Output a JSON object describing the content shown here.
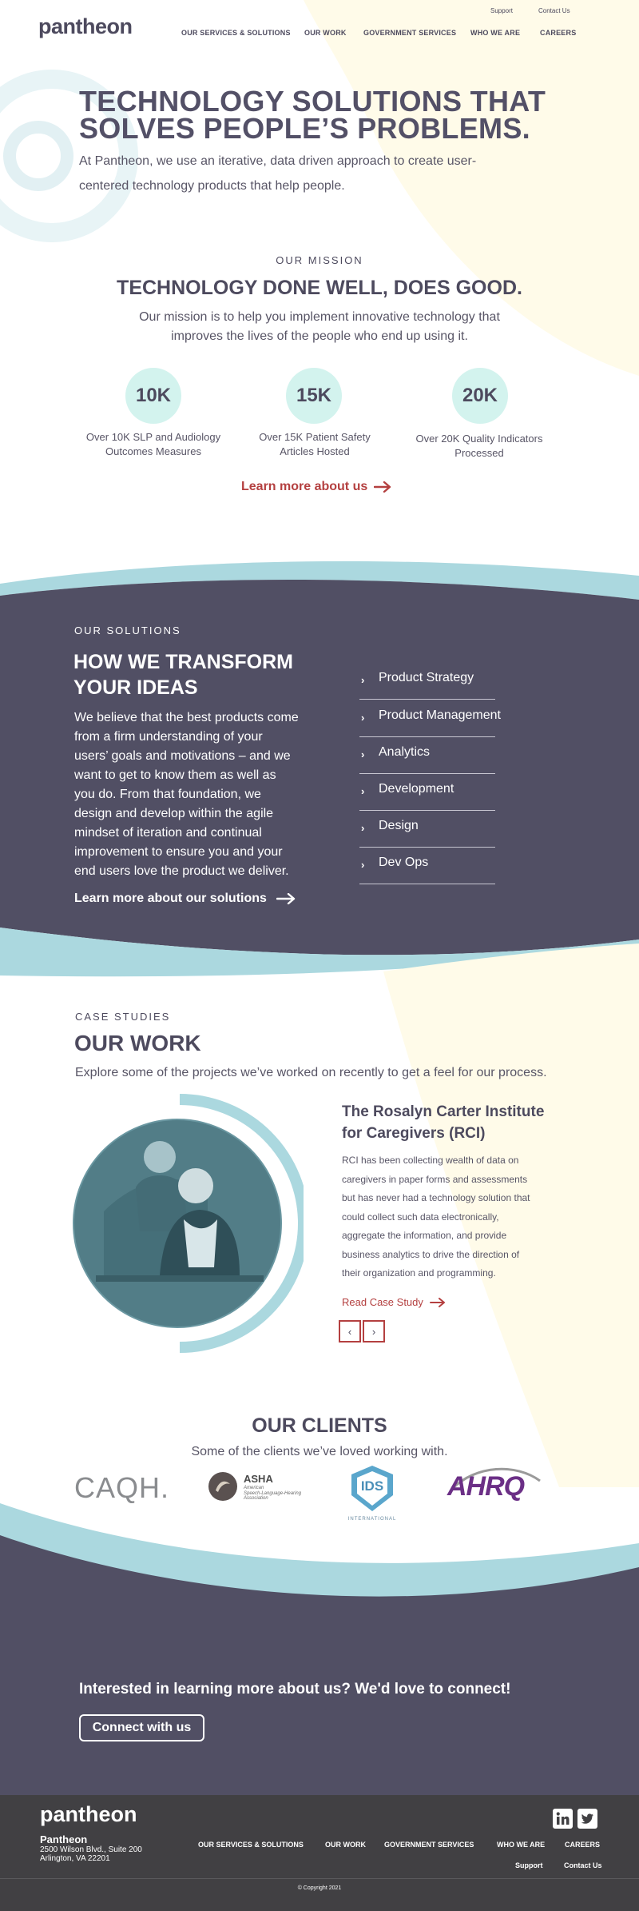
{
  "header": {
    "logo": "pantheon",
    "utility": [
      "Support",
      "Contact Us"
    ],
    "nav": [
      "OUR SERVICES & SOLUTIONS",
      "OUR WORK",
      "GOVERNMENT SERVICES",
      "WHO WE ARE",
      "CAREERS"
    ]
  },
  "hero": {
    "title_line1": "TECHNOLOGY SOLUTIONS THAT",
    "title_line2": "SOLVES PEOPLE’S PROBLEMS.",
    "desc_line1": "At Pantheon, we use an iterative, data driven approach to create user-",
    "desc_line2": "centered technology products that help people."
  },
  "mission": {
    "eyebrow": "OUR MISSION",
    "title": "TECHNOLOGY DONE WELL, DOES GOOD.",
    "desc_line1": "Our mission is to help you implement innovative technology that",
    "desc_line2": "improves the lives of the people who end up using it.",
    "stats": [
      {
        "value": "10K",
        "label_line1": "Over 10K SLP and Audiology",
        "label_line2": "Outcomes Measures"
      },
      {
        "value": "15K",
        "label_line1": "Over 15K Patient Safety",
        "label_line2": "Articles Hosted"
      },
      {
        "value": "20K",
        "label_line1": "Over 20K Quality Indicators",
        "label_line2": "Processed"
      }
    ],
    "link": "Learn more about us"
  },
  "solutions": {
    "eyebrow": "OUR SOLUTIONS",
    "title_line1": "HOW WE TRANSFORM",
    "title_line2": "YOUR IDEAS",
    "desc_lines": [
      "We believe that the best products come",
      "from a firm understanding of your",
      "users’ goals and motivations – and we",
      "want to get to know them as well as",
      "you do. From that foundation, we",
      "design and develop within the agile",
      "mindset of iteration and continual",
      "improvement to ensure you and your",
      "end users love the product we deliver."
    ],
    "link": "Learn more about our solutions",
    "items": [
      "Product Strategy",
      "Product Management",
      "Analytics",
      "Development",
      "Design",
      "Dev Ops"
    ]
  },
  "work": {
    "eyebrow": "CASE STUDIES",
    "title": "OUR WORK",
    "desc": "Explore some of the projects we’ve worked on recently to get a feel for our process.",
    "case": {
      "title_line1": "The Rosalyn Carter Institute",
      "title_line2": "for Caregivers (RCI)",
      "body_lines": [
        "RCI has been collecting wealth of data on",
        "caregivers in paper forms and assessments",
        "but has never had a technology solution that",
        "could collect such data electronically,",
        "aggregate the information, and provide",
        "business analytics to drive the direction of",
        "their organization and programming."
      ],
      "link": "Read Case Study"
    },
    "pager_prev": "‹",
    "pager_next": "›"
  },
  "clients": {
    "title": "OUR CLIENTS",
    "desc": "Some of the clients we’ve loved working with.",
    "logos": {
      "caqh": "CAQH.",
      "asha_name": "ASHA",
      "asha_sub_line1": "American",
      "asha_sub_line2": "Speech-Language-Hearing",
      "asha_sub_line3": "Association",
      "ids": "IDS",
      "ids_sub": "INTERNATIONAL",
      "ahrq": "AHRQ"
    }
  },
  "cta": {
    "title": "Interested in learning more about us? We'd love to connect!",
    "button": "Connect with us"
  },
  "footer": {
    "logo": "pantheon",
    "company": "Pantheon",
    "address_line1": "2500 Wilson Blvd., Suite 200",
    "address_line2": "Arlington, VA 22201",
    "nav": [
      "OUR SERVICES & SOLUTIONS",
      "OUR WORK",
      "GOVERNMENT SERVICES",
      "WHO WE ARE",
      "CAREERS"
    ],
    "support": "Support",
    "contact": "Contact Us",
    "copyright": "© Copyright 2021"
  },
  "colors": {
    "primary_dark": "#4d4a5e",
    "accent_red": "#b44040",
    "light_blue": "#abd8df",
    "mint": "#d3f3ee",
    "cream": "#fffbe9",
    "footer_bg": "#414043"
  }
}
